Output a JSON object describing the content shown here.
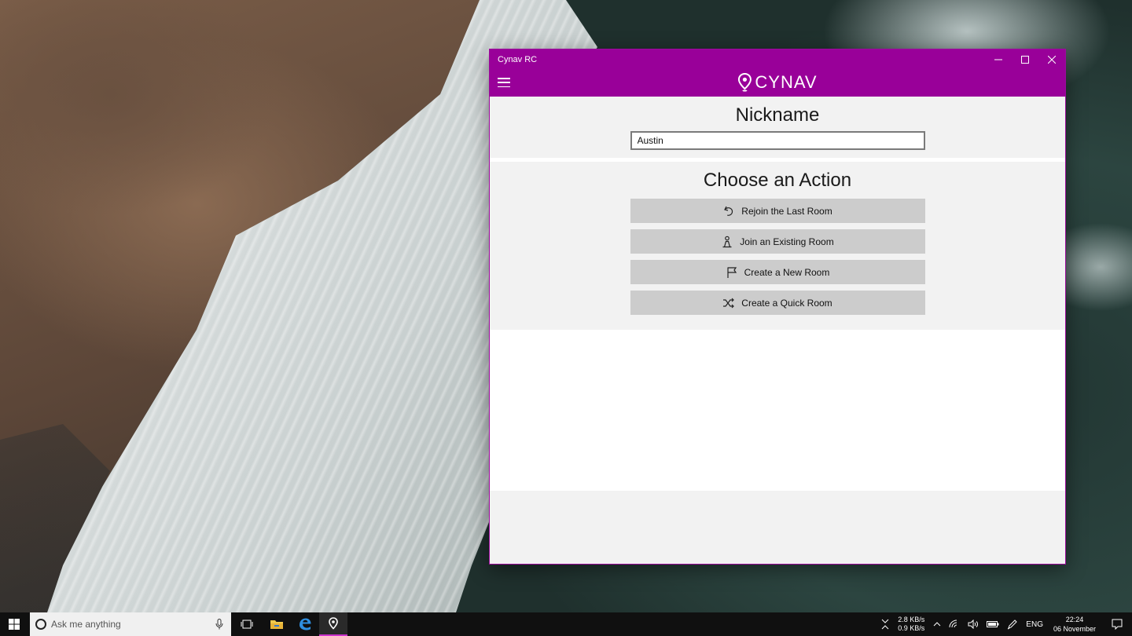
{
  "window": {
    "title": "Cynav RC",
    "controls": {
      "minimize": "—",
      "maximize": "☐",
      "close": "✕"
    }
  },
  "appbar": {
    "brand": "CYNAV",
    "menu_icon": "hamburger-icon",
    "logo_icon": "map-pin-icon"
  },
  "nickname": {
    "title": "Nickname",
    "value": "Austin"
  },
  "actions": {
    "title": "Choose an Action",
    "buttons": [
      {
        "label": "Rejoin the Last Room",
        "icon": "undo-icon"
      },
      {
        "label": "Join an Existing Room",
        "icon": "person-icon"
      },
      {
        "label": "Create a New Room",
        "icon": "flag-icon"
      },
      {
        "label": "Create a Quick Room",
        "icon": "shuffle-icon"
      }
    ]
  },
  "taskbar": {
    "search_placeholder": "Ask me anything",
    "net_down": "2.8 KB/s",
    "net_up": "0.9 KB/s",
    "language": "ENG",
    "time": "22:24",
    "date": "06 November"
  },
  "colors": {
    "accent": "#990099",
    "button": "#cccccc",
    "panel": "#f2f2f2"
  }
}
